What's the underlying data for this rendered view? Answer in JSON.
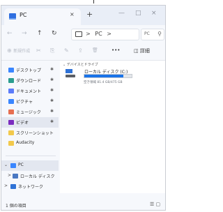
{
  "window": {
    "tab_title": "PC",
    "tab_close": "×",
    "new_tab": "+",
    "minimize": "—",
    "maximize": "□",
    "close": "×"
  },
  "nav": {
    "back": "←",
    "forward": "→",
    "up": "↑",
    "refresh": "↻"
  },
  "address": {
    "path_sep": ">",
    "location": "PC",
    "chevron": ">",
    "search_placeholder": "PC",
    "search_icon": "⚲"
  },
  "commandbar": {
    "new_label": "新規作成",
    "cut": "✂",
    "copy": "⎘",
    "rename": "✎",
    "share": "⇪",
    "delete": "🗑",
    "more": "•••",
    "details": "詳細"
  },
  "sidebar": {
    "quick_access": [
      {
        "label": "デスクトップ",
        "color": "#3a86ff"
      },
      {
        "label": "ダウンロード",
        "color": "#2a9d8f"
      },
      {
        "label": "ドキュメント",
        "color": "#5c7cfa"
      },
      {
        "label": "ピクチャ",
        "color": "#3a86ff"
      },
      {
        "label": "ミュージック",
        "color": "#e76f51"
      },
      {
        "label": "ビデオ",
        "color": "#7b2cbf"
      },
      {
        "label": "スクリーンショット",
        "color": "#f2c94c"
      },
      {
        "label": "Audacity",
        "color": "#f2c94c"
      }
    ],
    "pin": "✱",
    "tree": [
      {
        "label": "PC",
        "chev": "⌄",
        "color": "#3a86ff"
      },
      {
        "label": "ローカル ディスク",
        "chev": ">",
        "color": "#4a78c2"
      },
      {
        "label": "ネットワーク",
        "chev": ">",
        "color": "#2f72d6"
      }
    ]
  },
  "main": {
    "group_header": "デバイスとドライブ",
    "drive": {
      "name": "ローカル ディスク (C:)",
      "space": "空き領域 81.4 GB/475 GB",
      "used_fraction": 0.83
    }
  },
  "status": {
    "count": "1 個の項目",
    "view_icons": "☰ ▢"
  }
}
